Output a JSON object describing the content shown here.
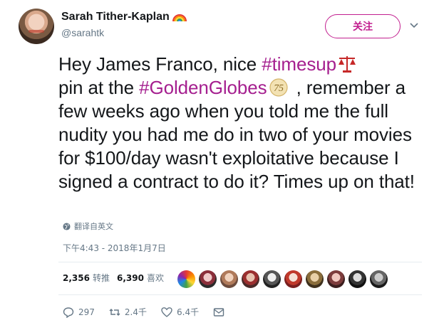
{
  "user": {
    "display_name": "Sarah Tither-Kaplan",
    "handle": "@sarahtk"
  },
  "follow_button": {
    "label": "关注"
  },
  "tweet": {
    "parts": {
      "p1": "Hey James Franco, nice ",
      "hashtag1": "#timesup",
      "p2": "pin at the ",
      "hashtag2": "#GoldenGlobes",
      "p3": " , remember a few weeks ago when you told me the full nudity you had me do in two of your movies for $100/day wasn't exploitative because I signed a contract to do it? Times up on that!"
    },
    "badge_text": "75"
  },
  "translate": {
    "label": "翻译自英文"
  },
  "timestamp": "下午4:43 - 2018年1月7日",
  "stats": {
    "retweets_count": "2,356",
    "retweets_label": "转推",
    "likes_count": "6,390",
    "likes_label": "喜欢"
  },
  "actions": {
    "reply_count": "297",
    "retweet_count": "2.4千",
    "like_count": "6.4千"
  },
  "colors": {
    "hashtag": "#a51f8f",
    "follow_accent": "#c21f8f",
    "secondary_text": "#657786"
  },
  "icons": [
    "rainbow-icon",
    "chevron-down-icon",
    "scales-icon",
    "golden-globes-75-icon",
    "globe-icon",
    "reply-icon",
    "retweet-icon",
    "heart-icon",
    "message-icon"
  ]
}
